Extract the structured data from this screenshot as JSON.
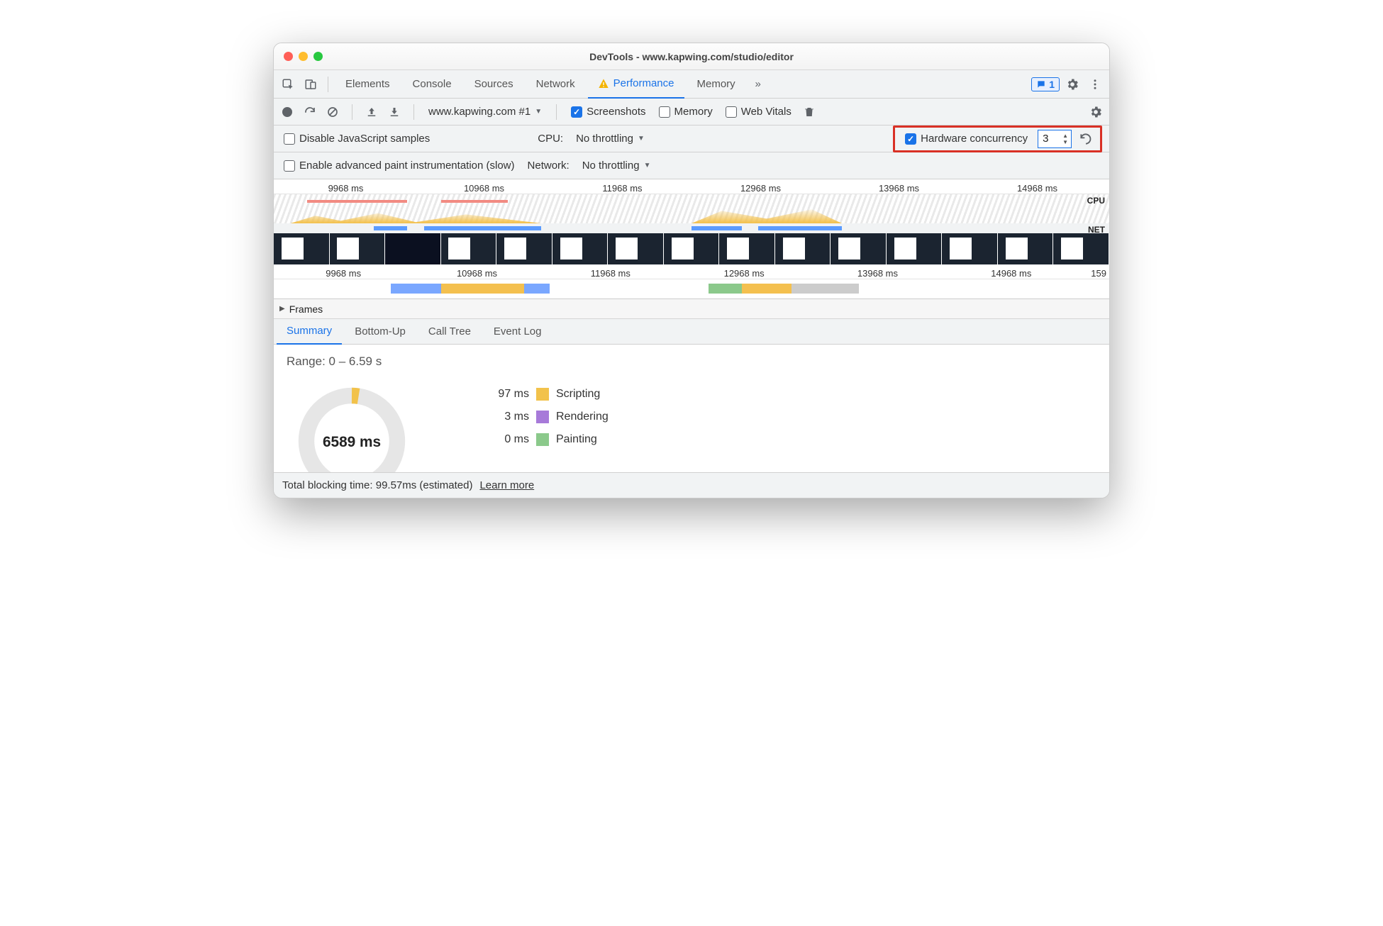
{
  "window": {
    "title": "DevTools - www.kapwing.com/studio/editor"
  },
  "tabs": {
    "items": [
      "Elements",
      "Console",
      "Sources",
      "Network",
      "Performance",
      "Memory"
    ],
    "active": "Performance",
    "moreGlyph": "»",
    "badgeCount": "1"
  },
  "toolbar": {
    "recordingDropdown": "www.kapwing.com #1",
    "screenshots": {
      "label": "Screenshots",
      "checked": true
    },
    "memory": {
      "label": "Memory",
      "checked": false
    },
    "webvitals": {
      "label": "Web Vitals",
      "checked": false
    }
  },
  "row2": {
    "disableJS": {
      "label": "Disable JavaScript samples",
      "checked": false
    },
    "cpuLabel": "CPU:",
    "cpuValue": "No throttling",
    "hwConcurrency": {
      "label": "Hardware concurrency",
      "checked": true,
      "value": "3"
    }
  },
  "row3": {
    "advPaint": {
      "label": "Enable advanced paint instrumentation (slow)",
      "checked": false
    },
    "netLabel": "Network:",
    "netValue": "No throttling"
  },
  "overview": {
    "ticksTop": [
      "9968 ms",
      "10968 ms",
      "11968 ms",
      "12968 ms",
      "13968 ms",
      "14968 ms"
    ],
    "ticksBottom": [
      "9968 ms",
      "10968 ms",
      "11968 ms",
      "12968 ms",
      "13968 ms",
      "14968 ms",
      "159"
    ],
    "cpuLabel": "CPU",
    "netLabel": "NET"
  },
  "frames": {
    "label": "Frames"
  },
  "subtabs": {
    "items": [
      "Summary",
      "Bottom-Up",
      "Call Tree",
      "Event Log"
    ],
    "active": "Summary"
  },
  "summary": {
    "range": "Range: 0 – 6.59 s",
    "total": "6589 ms",
    "legend": [
      {
        "value": "97 ms",
        "color": "y",
        "label": "Scripting"
      },
      {
        "value": "3 ms",
        "color": "p",
        "label": "Rendering"
      },
      {
        "value": "0 ms",
        "color": "g",
        "label": "Painting"
      }
    ]
  },
  "footer": {
    "text": "Total blocking time: 99.57ms (estimated)",
    "link": "Learn more"
  }
}
